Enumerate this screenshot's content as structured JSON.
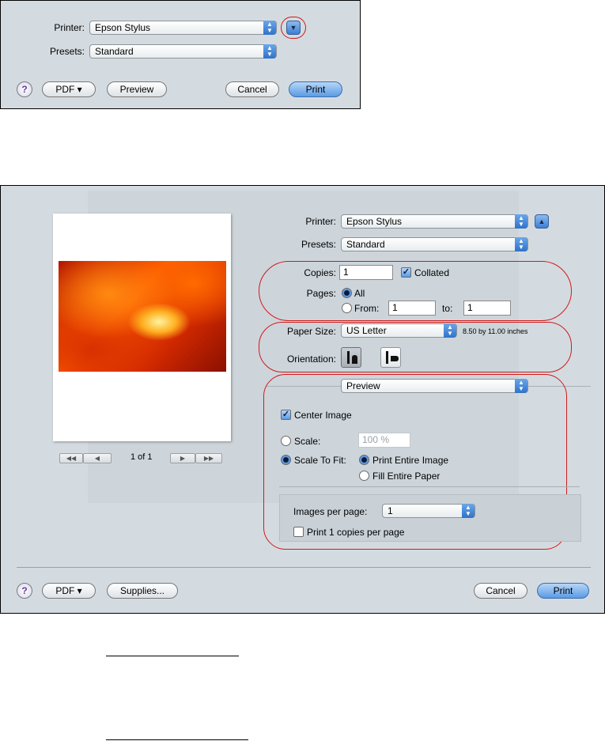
{
  "top_dialog": {
    "printer_label": "Printer:",
    "printer_value": "Epson Stylus",
    "presets_label": "Presets:",
    "presets_value": "Standard",
    "help_label": "?",
    "pdf_label": "PDF ▾",
    "preview_label": "Preview",
    "cancel_label": "Cancel",
    "print_label": "Print",
    "disclosure_icon": "triangle-down-icon"
  },
  "bottom_dialog": {
    "printer_label": "Printer:",
    "printer_value": "Epson Stylus",
    "presets_label": "Presets:",
    "presets_value": "Standard",
    "copies_label": "Copies:",
    "copies_value": "1",
    "collated_label": "Collated",
    "collated_checked": true,
    "pages_label": "Pages:",
    "pages_all_label": "All",
    "pages_from_label": "From:",
    "pages_from_value": "1",
    "pages_to_label": "to:",
    "pages_to_value": "1",
    "paper_size_label": "Paper Size:",
    "paper_size_value": "US Letter",
    "paper_size_desc": "8.50 by 11.00 inches",
    "orientation_label": "Orientation:",
    "section_popup_value": "Preview",
    "center_image_label": "Center Image",
    "scale_label": "Scale:",
    "scale_value": "100 %",
    "scale_to_fit_label": "Scale To Fit:",
    "print_entire_label": "Print Entire Image",
    "fill_paper_label": "Fill Entire Paper",
    "images_per_page_label": "Images per page:",
    "images_per_page_value": "1",
    "print_copies_label": "Print 1 copies per page",
    "page_indicator": "1 of 1",
    "help_label": "?",
    "pdf_label": "PDF ▾",
    "supplies_label": "Supplies...",
    "cancel_label": "Cancel",
    "print_label": "Print",
    "disclosure_icon": "triangle-up-icon"
  },
  "colors": {
    "panel_bg": "#d4dbe0",
    "highlight_ring": "#d01a1a",
    "accent_blue": "#3b7fd6"
  }
}
